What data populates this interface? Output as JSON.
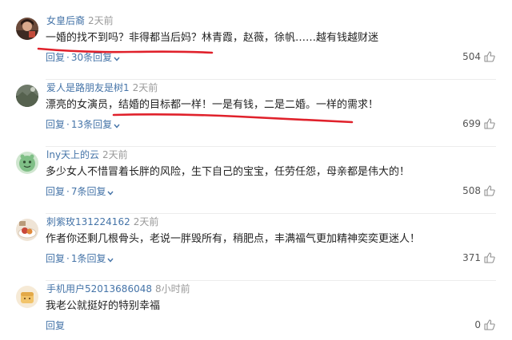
{
  "colors": {
    "link": "#4574a8",
    "time": "#999999",
    "text": "#222222",
    "likes": "#555555",
    "annotation": "#e0212b"
  },
  "comments": [
    {
      "username": "女皇后裔",
      "time": "2天前",
      "text": "一婚的找不到吗？非得都当后妈？林青霞，赵薇，徐帆……越有钱越财迷",
      "reply_label": "回复",
      "replies_label": "30条回复",
      "likes": "504",
      "avatar_icon": "avatar-photo-woman-icon"
    },
    {
      "username": "爱人是路朋友是树1",
      "time": "2天前",
      "text": "漂亮的女演员，结婚的目标都一样！一是有钱，二是二婚。一样的需求！",
      "reply_label": "回复",
      "replies_label": "13条回复",
      "likes": "699",
      "avatar_icon": "avatar-photo-landscape-icon"
    },
    {
      "username": "lny天上的云",
      "time": "2天前",
      "text": "多少女人不惜冒着长胖的风险，生下自己的宝宝，任劳任怨，母亲都是伟大的！",
      "reply_label": "回复",
      "replies_label": "7条回复",
      "likes": "508",
      "avatar_icon": "avatar-cartoon-face-icon"
    },
    {
      "username": "刺紫玫131224162",
      "time": "2天前",
      "text": "作者你还剩几根骨头，老说一胖毁所有，稍肥点，丰满福气更加精神奕奕更迷人！",
      "reply_label": "回复",
      "replies_label": "1条回复",
      "likes": "371",
      "avatar_icon": "avatar-photo-food-icon"
    },
    {
      "username": "手机用户52013686048",
      "time": "8小时前",
      "text": "我老公就挺好的特别幸福",
      "reply_label": "回复",
      "replies_label": "",
      "likes": "0",
      "avatar_icon": "avatar-default-bread-icon"
    }
  ]
}
